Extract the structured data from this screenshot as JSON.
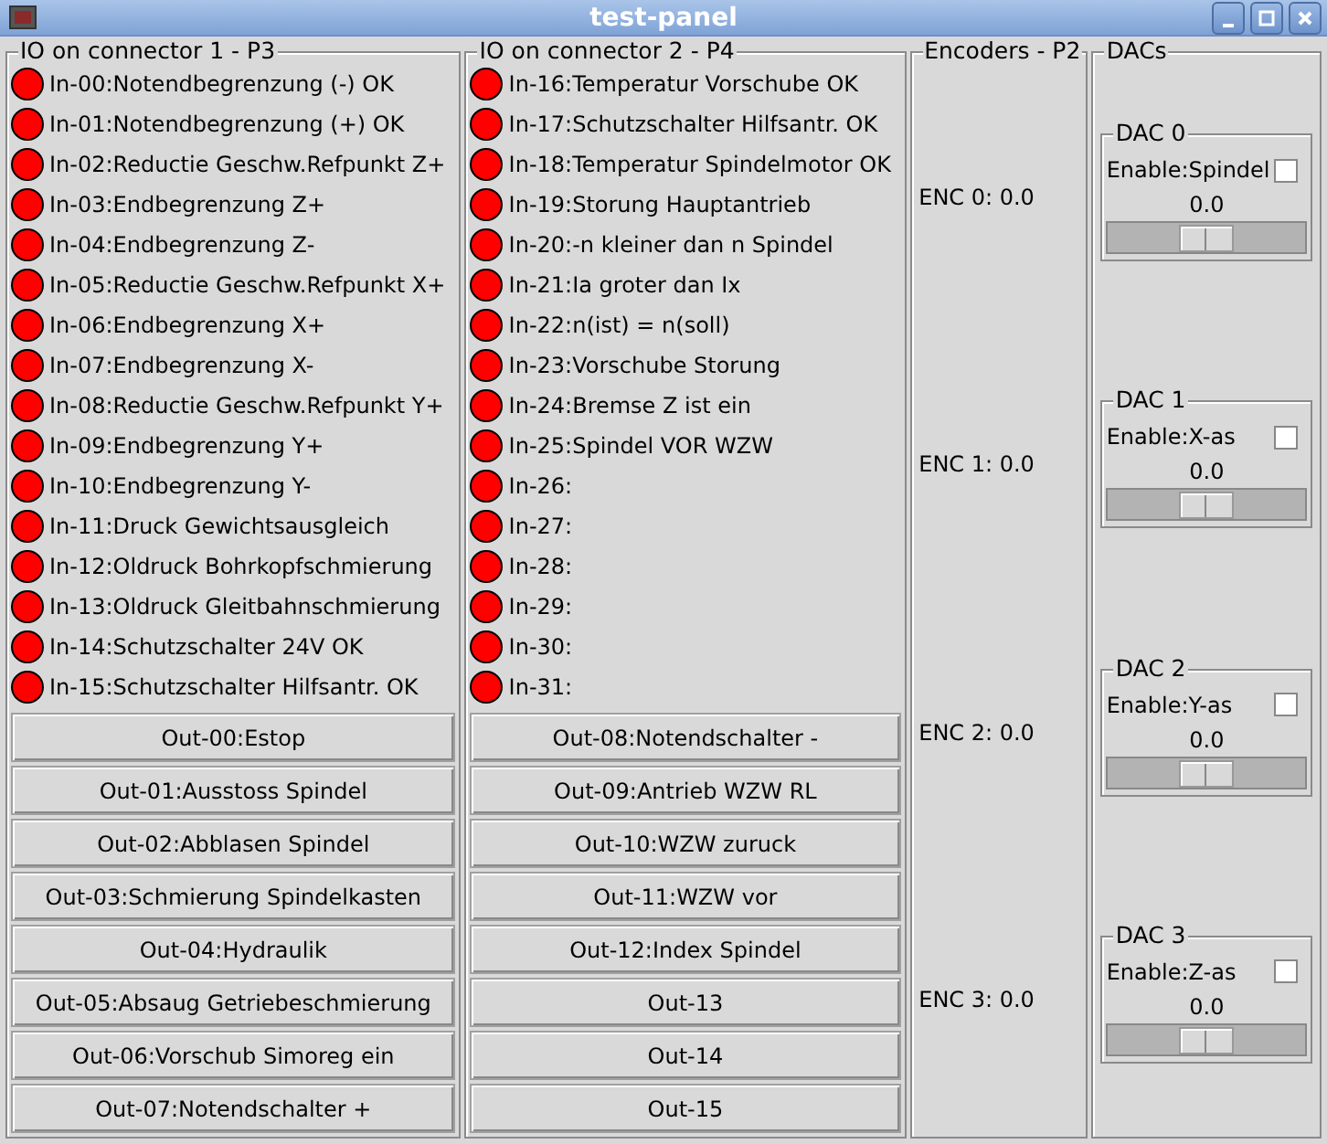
{
  "window": {
    "title": "test-panel"
  },
  "io_groups": [
    {
      "title": "IO on connector 1 - P3",
      "inputs": [
        {
          "label": "In-00:Notendbegrenzung (-) OK",
          "on": false
        },
        {
          "label": "In-01:Notendbegrenzung (+) OK",
          "on": false
        },
        {
          "label": "In-02:Reductie Geschw.Refpunkt Z+",
          "on": false
        },
        {
          "label": "In-03:Endbegrenzung Z+",
          "on": false
        },
        {
          "label": "In-04:Endbegrenzung Z-",
          "on": false
        },
        {
          "label": "In-05:Reductie Geschw.Refpunkt X+",
          "on": false
        },
        {
          "label": "In-06:Endbegrenzung X+",
          "on": false
        },
        {
          "label": "In-07:Endbegrenzung X-",
          "on": false
        },
        {
          "label": "In-08:Reductie Geschw.Refpunkt Y+",
          "on": false
        },
        {
          "label": "In-09:Endbegrenzung Y+",
          "on": false
        },
        {
          "label": "In-10:Endbegrenzung Y-",
          "on": false
        },
        {
          "label": "In-11:Druck Gewichtsausgleich",
          "on": false
        },
        {
          "label": "In-12:Oldruck Bohrkopfschmierung",
          "on": false
        },
        {
          "label": "In-13:Oldruck Gleitbahnschmierung",
          "on": false
        },
        {
          "label": "In-14:Schutzschalter 24V OK",
          "on": false
        },
        {
          "label": "In-15:Schutzschalter Hilfsantr. OK",
          "on": false
        }
      ],
      "outputs": [
        "Out-00:Estop",
        "Out-01:Ausstoss Spindel",
        "Out-02:Abblasen Spindel",
        "Out-03:Schmierung Spindelkasten",
        "Out-04:Hydraulik",
        "Out-05:Absaug Getriebeschmierung",
        "Out-06:Vorschub Simoreg ein",
        "Out-07:Notendschalter +"
      ]
    },
    {
      "title": "IO on connector 2 - P4",
      "inputs": [
        {
          "label": "In-16:Temperatur Vorschube OK",
          "on": false
        },
        {
          "label": "In-17:Schutzschalter Hilfsantr. OK",
          "on": false
        },
        {
          "label": "In-18:Temperatur Spindelmotor OK",
          "on": false
        },
        {
          "label": "In-19:Storung Hauptantrieb",
          "on": false
        },
        {
          "label": "In-20:-n kleiner dan n Spindel",
          "on": false
        },
        {
          "label": "In-21:Ia groter dan Ix",
          "on": false
        },
        {
          "label": "In-22:n(ist) = n(soll)",
          "on": false
        },
        {
          "label": "In-23:Vorschube Storung",
          "on": false
        },
        {
          "label": "In-24:Bremse Z ist ein",
          "on": false
        },
        {
          "label": "In-25:Spindel VOR WZW",
          "on": false
        },
        {
          "label": "In-26:",
          "on": false
        },
        {
          "label": "In-27:",
          "on": false
        },
        {
          "label": "In-28:",
          "on": false
        },
        {
          "label": "In-29:",
          "on": false
        },
        {
          "label": "In-30:",
          "on": false
        },
        {
          "label": "In-31:",
          "on": false
        }
      ],
      "outputs": [
        "Out-08:Notendschalter -",
        "Out-09:Antrieb WZW RL",
        "Out-10:WZW zuruck",
        "Out-11:WZW vor",
        "Out-12:Index Spindel",
        "Out-13",
        "Out-14",
        "Out-15"
      ]
    }
  ],
  "encoders": {
    "title": "Encoders - P2",
    "items": [
      "ENC 0: 0.0",
      "ENC 1: 0.0",
      "ENC 2: 0.0",
      "ENC 3: 0.0"
    ]
  },
  "dacs": {
    "title": "DACs",
    "items": [
      {
        "title": "DAC 0",
        "enable_label": "Enable:Spindel",
        "checked": false,
        "value": "0.0",
        "level": 0.5
      },
      {
        "title": "DAC 1",
        "enable_label": "Enable:X-as",
        "checked": false,
        "value": "0.0",
        "level": 0.5
      },
      {
        "title": "DAC 2",
        "enable_label": "Enable:Y-as",
        "checked": false,
        "value": "0.0",
        "level": 0.5
      },
      {
        "title": "DAC 3",
        "enable_label": "Enable:Z-as",
        "checked": false,
        "value": "0.0",
        "level": 0.5
      }
    ]
  }
}
